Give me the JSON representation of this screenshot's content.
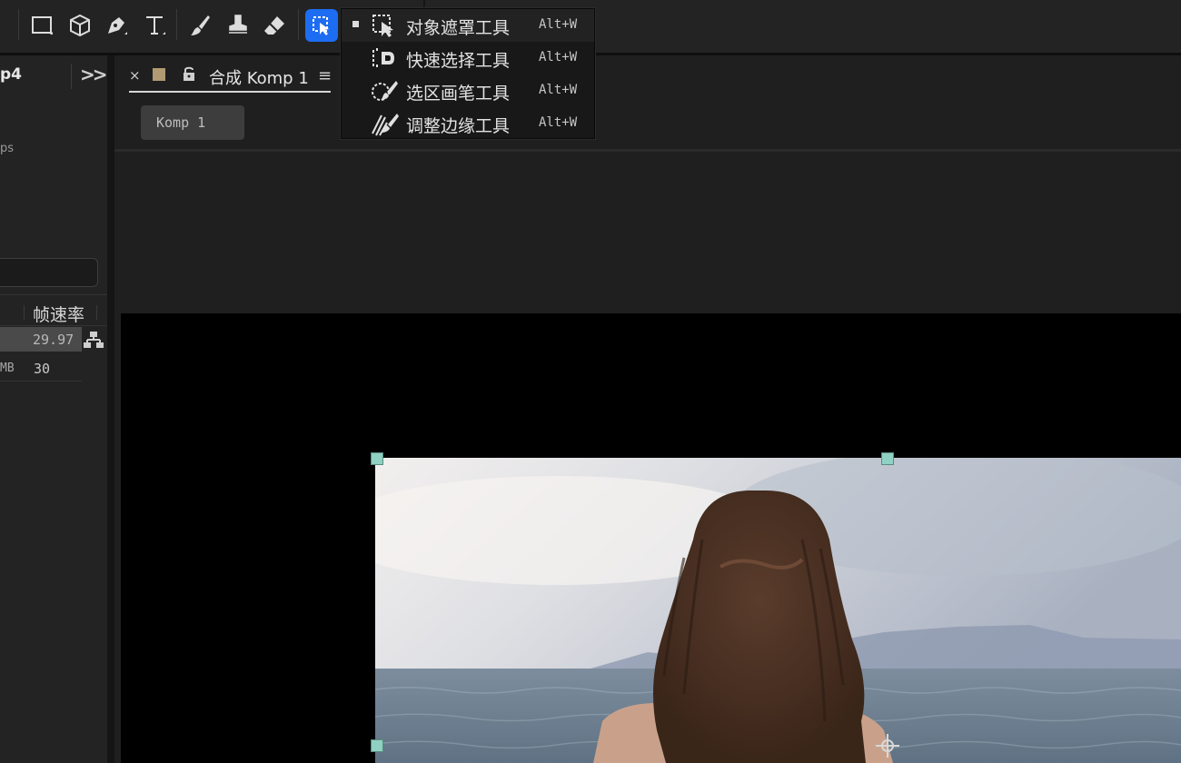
{
  "toolbar": {
    "tools": [
      "rectangle-tool",
      "3d-cube-tool",
      "pen-tool",
      "type-tool",
      "brush-tool",
      "clone-stamp-tool",
      "eraser-tool",
      "roto-brush-tool"
    ],
    "active_tool": "roto-brush-tool",
    "accent_color": "#1d6df2"
  },
  "left_panel": {
    "title": "p4",
    "more_icon": "chevrons-right-icon",
    "info_text": "ps",
    "column_header": "帧速率",
    "rows": [
      {
        "size": "",
        "frame_rate": "29.97"
      },
      {
        "size": "MB",
        "frame_rate": "30"
      }
    ]
  },
  "comp_panel": {
    "tab": {
      "close": "×",
      "label": "合成 Komp 1",
      "menu": "≡",
      "swatch_color": "#b29a72"
    },
    "sub_button": "Komp 1"
  },
  "dropdown": {
    "items": [
      {
        "label": "对象遮罩工具",
        "shortcut": "Alt+W",
        "icon": "object-mask-icon",
        "selected": true
      },
      {
        "label": "快速选择工具",
        "shortcut": "Alt+W",
        "icon": "quick-select-icon",
        "selected": false
      },
      {
        "label": "选区画笔工具",
        "shortcut": "Alt+W",
        "icon": "selection-brush-icon",
        "selected": false
      },
      {
        "label": "调整边缘工具",
        "shortcut": "Alt+W",
        "icon": "refine-edge-icon",
        "selected": false
      }
    ]
  },
  "viewer": {
    "handle_color": "#8fd1c3"
  }
}
